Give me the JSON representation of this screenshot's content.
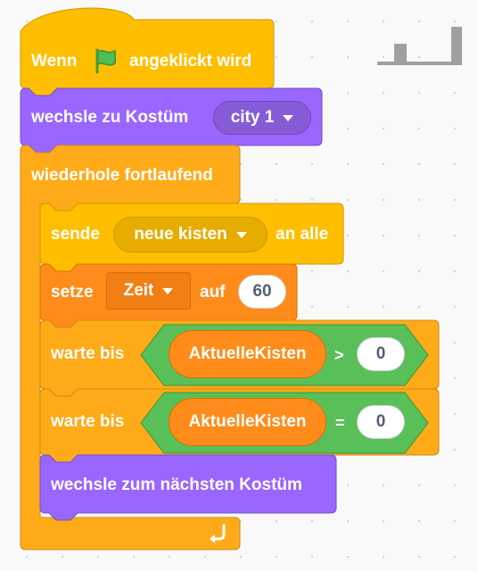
{
  "script": {
    "hat_block": {
      "prefix": "Wenn",
      "suffix": "angeklickt wird",
      "icon": "green-flag-icon"
    },
    "switch_costume": {
      "label": "wechsle zu Kostüm",
      "costume": "city 1"
    },
    "forever": {
      "label": "wiederhole fortlaufend",
      "icon": "loop-arrow-icon"
    },
    "broadcast": {
      "prefix": "sende",
      "message": "neue kisten",
      "suffix": "an alle"
    },
    "set_var": {
      "prefix": "setze",
      "variable": "Zeit",
      "middle": "auf",
      "value": "60"
    },
    "wait_until_1": {
      "label": "warte bis",
      "reporter": "AktuelleKisten",
      "operator": ">",
      "value": "0"
    },
    "wait_until_2": {
      "label": "warte bis",
      "reporter": "AktuelleKisten",
      "operator": "=",
      "value": "0"
    },
    "next_costume": {
      "label": "wechsle zum nächsten Kostüm"
    }
  },
  "workspace": {
    "cleanup_icon": "cleanup-icon"
  },
  "colors": {
    "events": "#ffbf00",
    "looks": "#9966ff",
    "control": "#ffab19",
    "variables": "#ff8c1a",
    "operators": "#59c059",
    "flag": "#4cbf56"
  }
}
